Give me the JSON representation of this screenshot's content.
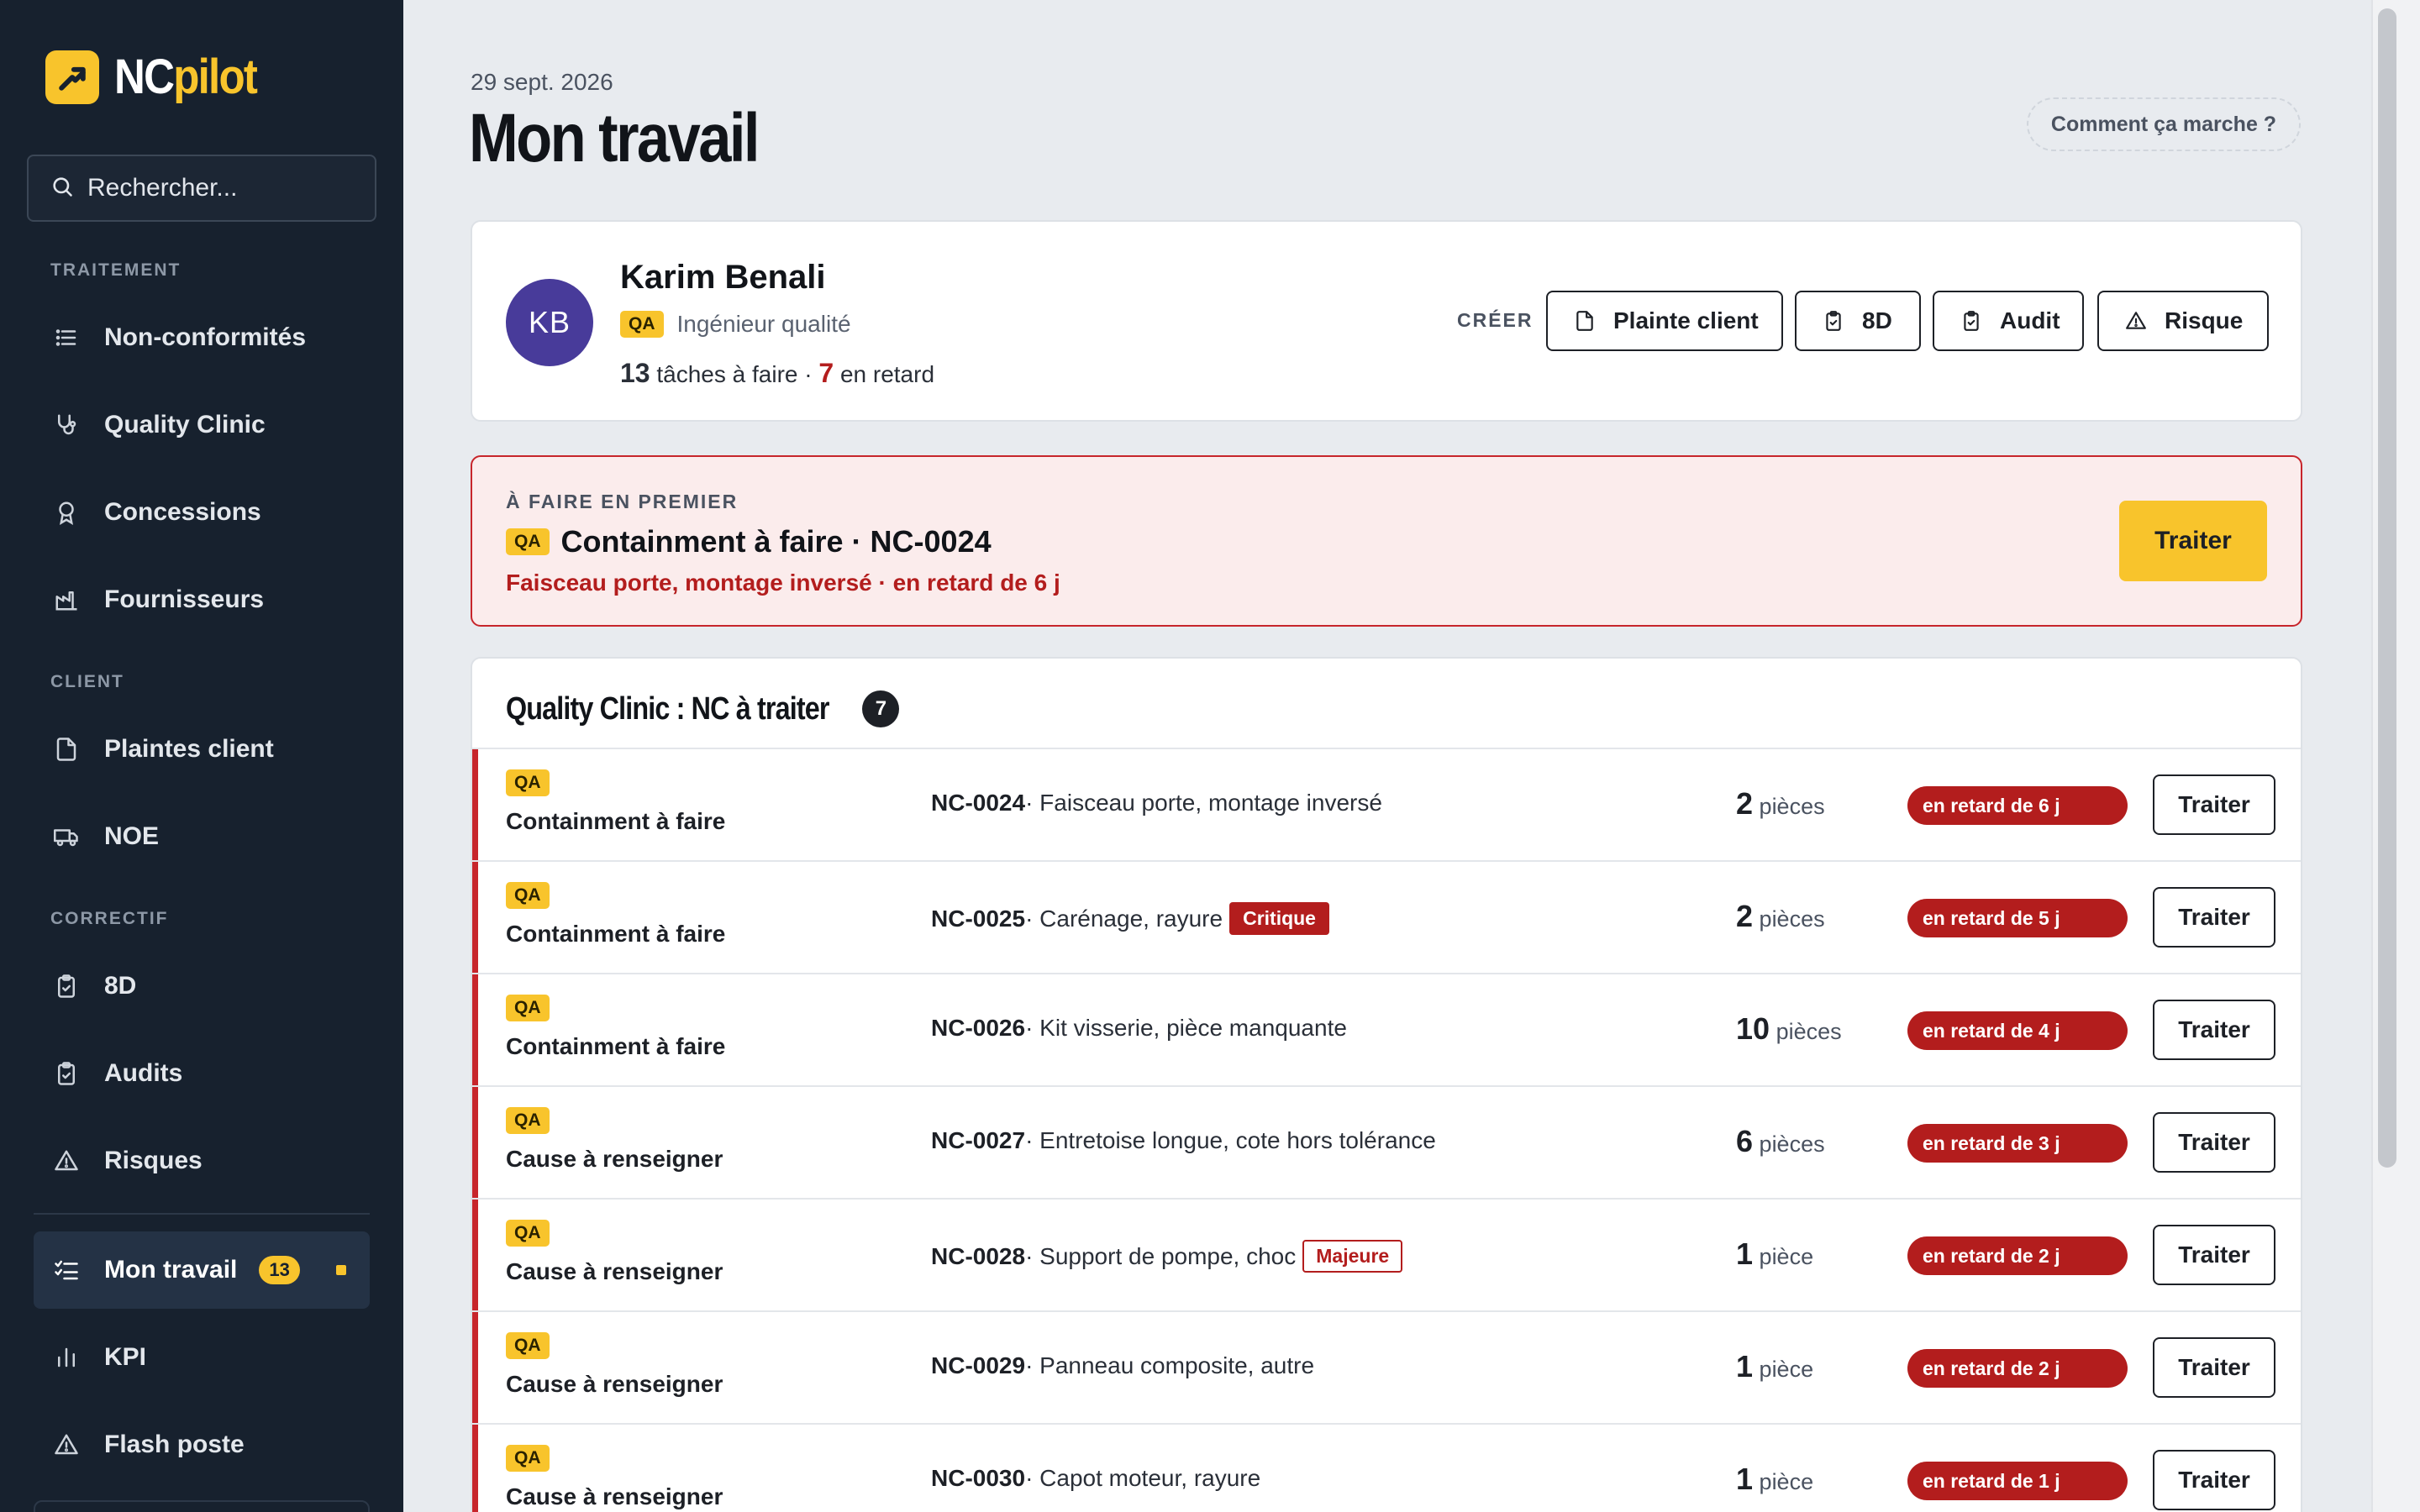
{
  "app": {
    "logo_nc": "NC",
    "logo_pilot": "pilot",
    "brand_color": "#f8c42c"
  },
  "sidebar": {
    "search_placeholder": "Rechercher...",
    "sections": {
      "traitement": "TRAITEMENT",
      "client": "CLIENT",
      "correctif": "CORRECTIF"
    },
    "items": [
      {
        "label": "Non-conformités",
        "icon": "list-icon"
      },
      {
        "label": "Quality Clinic",
        "icon": "stethoscope-icon"
      },
      {
        "label": "Concessions",
        "icon": "award-icon"
      },
      {
        "label": "Fournisseurs",
        "icon": "factory-icon"
      },
      {
        "label": "Plaintes client",
        "icon": "file-icon"
      },
      {
        "label": "NOE",
        "icon": "truck-icon"
      },
      {
        "label": "8D",
        "icon": "clipboard-check-icon"
      },
      {
        "label": "Audits",
        "icon": "clipboard-check-icon"
      },
      {
        "label": "Risques",
        "icon": "warning-icon"
      },
      {
        "label": "Mon travail",
        "icon": "checklist-icon",
        "badge": "13",
        "active": true
      },
      {
        "label": "KPI",
        "icon": "bar-chart-icon"
      },
      {
        "label": "Flash poste",
        "icon": "warning-icon"
      }
    ]
  },
  "header": {
    "date": "29 sept. 2026",
    "title": "Mon travail",
    "help": "Comment ça marche ?"
  },
  "profile": {
    "initials": "KB",
    "name": "Karim Benali",
    "tag": "QA",
    "role": "Ingénieur qualité",
    "tasks_count": "13",
    "tasks_label": "tâches à faire",
    "separator": "·",
    "late_count": "7",
    "late_label": "en retard",
    "create_label": "CRÉER",
    "create_buttons": [
      "Plainte client",
      "8D",
      "Audit",
      "Risque"
    ]
  },
  "priority": {
    "kicker": "À FAIRE EN PREMIER",
    "tag": "QA",
    "title": "Containment à faire · NC-0024",
    "subtitle": "Faisceau porte, montage inversé · en retard de 6 j",
    "action": "Traiter"
  },
  "list": {
    "title": "Quality Clinic : NC à traiter",
    "count": "7",
    "rows": [
      {
        "tag": "QA",
        "status": "Containment à faire",
        "id": "NC-0024",
        "desc": " · Faisceau porte, montage inversé",
        "severity": "",
        "qty": "2",
        "unit": "pièces",
        "late": "en retard de 6 j",
        "action": "Traiter"
      },
      {
        "tag": "QA",
        "status": "Containment à faire",
        "id": "NC-0025",
        "desc": " · Carénage, rayure",
        "severity": "Critique",
        "qty": "2",
        "unit": "pièces",
        "late": "en retard de 5 j",
        "action": "Traiter"
      },
      {
        "tag": "QA",
        "status": "Containment à faire",
        "id": "NC-0026",
        "desc": " · Kit visserie, pièce manquante",
        "severity": "",
        "qty": "10",
        "unit": "pièces",
        "late": "en retard de 4 j",
        "action": "Traiter"
      },
      {
        "tag": "QA",
        "status": "Cause à renseigner",
        "id": "NC-0027",
        "desc": " · Entretoise longue, cote hors tolérance",
        "severity": "",
        "qty": "6",
        "unit": "pièces",
        "late": "en retard de 3 j",
        "action": "Traiter"
      },
      {
        "tag": "QA",
        "status": "Cause à renseigner",
        "id": "NC-0028",
        "desc": " · Support de pompe, choc",
        "severity": "Majeure",
        "qty": "1",
        "unit": "pièce",
        "late": "en retard de 2 j",
        "action": "Traiter"
      },
      {
        "tag": "QA",
        "status": "Cause à renseigner",
        "id": "NC-0029",
        "desc": " · Panneau composite, autre",
        "severity": "",
        "qty": "1",
        "unit": "pièce",
        "late": "en retard de 2 j",
        "action": "Traiter"
      },
      {
        "tag": "QA",
        "status": "Cause à renseigner",
        "id": "NC-0030",
        "desc": " · Capot moteur, rayure",
        "severity": "",
        "qty": "1",
        "unit": "pièce",
        "late": "en retard de 1 j",
        "action": "Traiter"
      }
    ]
  },
  "colors": {
    "danger": "#b31d1d",
    "sidebar_bg": "#17212e",
    "page_bg": "#e8ebef"
  }
}
